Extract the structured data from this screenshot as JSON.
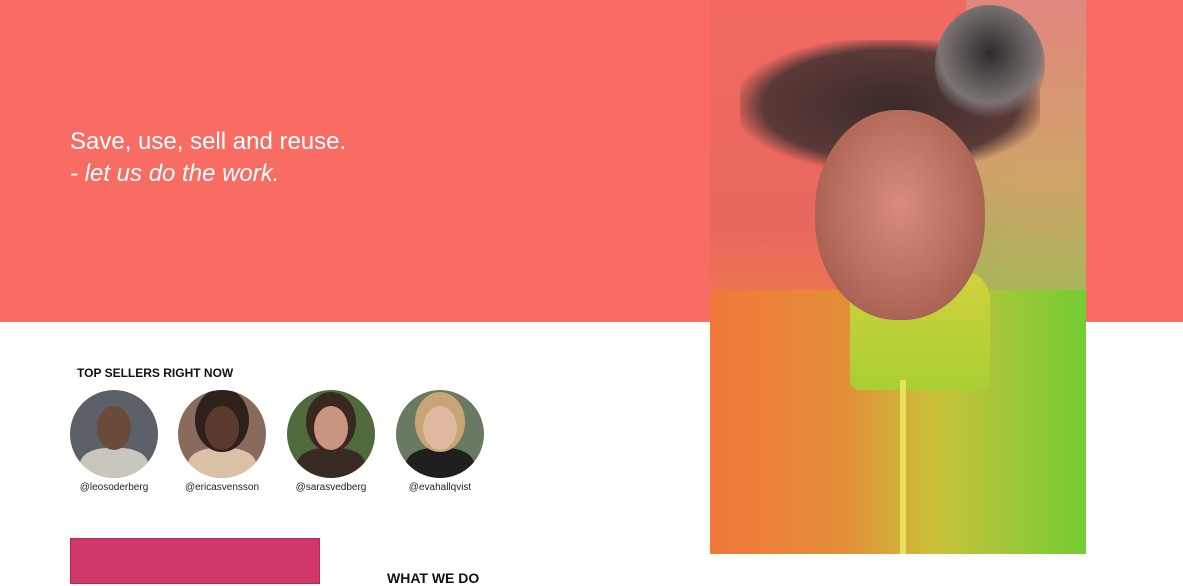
{
  "hero": {
    "tagline_line1": "Save, use, sell and reuse.",
    "tagline_line2": "- let us do the work."
  },
  "top_sellers": {
    "title": "TOP SELLERS RIGHT NOW",
    "items": [
      {
        "handle": "@leosoderberg"
      },
      {
        "handle": "@ericasvensson"
      },
      {
        "handle": "@sarasvedberg"
      },
      {
        "handle": "@evahallqvist"
      }
    ]
  },
  "section": {
    "what_we_do": "WHAT WE DO"
  },
  "colors": {
    "hero_bg": "#f86c64",
    "promo_block": "#d0386a"
  }
}
